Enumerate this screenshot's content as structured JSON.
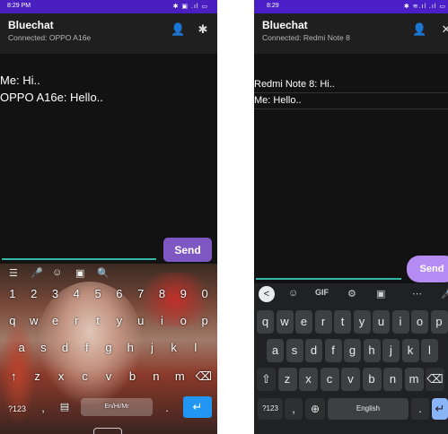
{
  "left": {
    "status_time": "8:29 PM",
    "status_icons": "✱ ▣ .ıl ▭",
    "app_title": "Bluechat",
    "app_subtitle": "Connected: OPPO A16e",
    "messages": [
      "Me: Hi..",
      "OPPO A16e: Hello.."
    ],
    "input_value": "",
    "send_label": "Send",
    "toolbar_icons": [
      "☰",
      "🎤",
      "☺",
      "▣",
      "🔍"
    ],
    "keyboard_rows": [
      [
        "1",
        "2",
        "3",
        "4",
        "5",
        "6",
        "7",
        "8",
        "9",
        "0"
      ],
      [
        "q",
        "w",
        "e",
        "r",
        "t",
        "y",
        "u",
        "i",
        "o",
        "p"
      ],
      [
        "a",
        "s",
        "d",
        "f",
        "g",
        "h",
        "j",
        "k",
        "l"
      ],
      [
        "↑",
        "z",
        "x",
        "c",
        "v",
        "b",
        "n",
        "m",
        "⌫"
      ]
    ],
    "bottom_row": {
      "sym": "?123",
      "comma": ",",
      "space": "En/Hi/Mr",
      "period": ".",
      "enter": "↵"
    }
  },
  "right": {
    "status_time": "8:29",
    "status_icons": "✱ ≋.ıl .ıl ▭",
    "app_title": "Bluechat",
    "app_subtitle": "Connected: Redmi Note 8",
    "messages": [
      "Redmi Note 8: Hi..",
      "Me: Hello.."
    ],
    "input_value": "",
    "send_label": "Send",
    "toolbar_items": [
      "<",
      "☺",
      "GIF",
      "⚙",
      "▣",
      "⋯",
      "🎤"
    ],
    "keyboard_rows": [
      [
        "q",
        "w",
        "e",
        "r",
        "t",
        "y",
        "u",
        "i",
        "o",
        "p"
      ],
      [
        "a",
        "s",
        "d",
        "f",
        "g",
        "h",
        "j",
        "k",
        "l"
      ],
      [
        "⇧",
        "z",
        "x",
        "c",
        "v",
        "b",
        "n",
        "m",
        "⌫"
      ]
    ],
    "bottom_row": {
      "sym": "?123",
      "comma": ",",
      "globe": "⊕",
      "space": "English",
      "period": ".",
      "enter": "↵"
    }
  }
}
